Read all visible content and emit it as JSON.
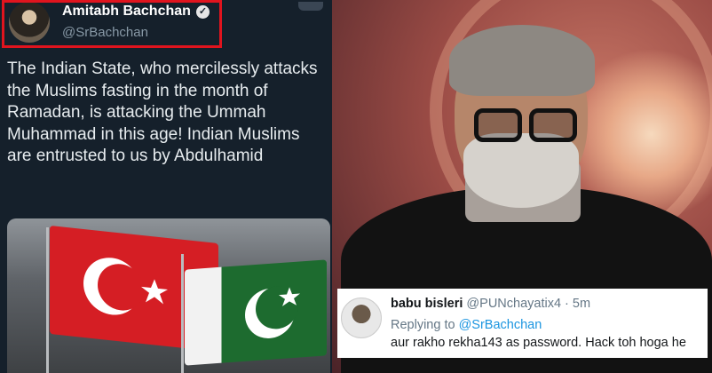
{
  "tweet": {
    "author_name": "Amitabh Bachchan",
    "author_handle": "@SrBachchan",
    "verified_icon": "verified-badge-icon",
    "text": "The Indian State, who mercilessly attacks the Muslims fasting in the month of Ramadan, is attacking the Ummah Muhammad in this age! Indian Muslims are entrusted to us by Abdulhamid",
    "highlight_color": "#e0141e"
  },
  "reply": {
    "author_name": "babu bisleri",
    "author_handle": "@PUNchayatix4",
    "separator": "·",
    "time": "5m",
    "replying_prefix": "Replying to",
    "replying_handle": "@SrBachchan",
    "text": "aur rakho rekha143 as password. Hack toh hoga he",
    "mention_color": "#1b95e0"
  }
}
